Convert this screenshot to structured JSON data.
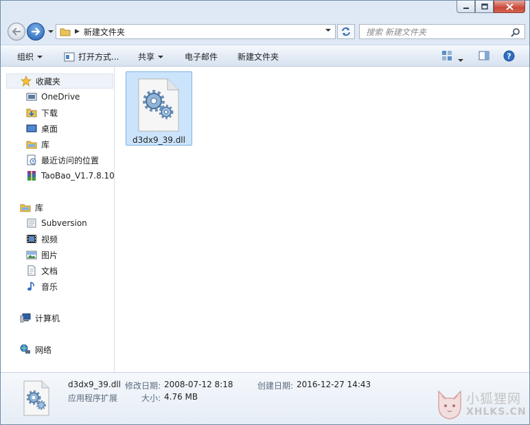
{
  "window": {
    "controls": {
      "minimize_icon": "minimize-icon",
      "maximize_icon": "maximize-icon",
      "close_icon": "close-icon"
    }
  },
  "address": {
    "path": "新建文件夹",
    "search_placeholder": "搜索 新建文件夹"
  },
  "toolbar": {
    "organize": "组织",
    "open_with": "打开方式...",
    "share": "共享",
    "email": "电子邮件",
    "new_folder": "新建文件夹"
  },
  "sidebar": {
    "favorites": {
      "label": "收藏夹",
      "items": [
        {
          "label": "OneDrive",
          "icon": "onedrive-icon"
        },
        {
          "label": "下载",
          "icon": "downloads-folder-icon"
        },
        {
          "label": "桌面",
          "icon": "desktop-icon"
        },
        {
          "label": "库",
          "icon": "library-folder-icon"
        },
        {
          "label": "最近访问的位置",
          "icon": "recent-places-icon"
        },
        {
          "label": "TaoBao_V1.7.8.10_",
          "icon": "winrar-archive-icon"
        }
      ]
    },
    "libraries": {
      "label": "库",
      "items": [
        {
          "label": "Subversion",
          "icon": "subversion-library-icon"
        },
        {
          "label": "视频",
          "icon": "video-library-icon"
        },
        {
          "label": "图片",
          "icon": "pictures-library-icon"
        },
        {
          "label": "文档",
          "icon": "documents-library-icon"
        },
        {
          "label": "音乐",
          "icon": "music-library-icon"
        }
      ]
    },
    "computer": {
      "label": "计算机"
    },
    "network": {
      "label": "网络"
    }
  },
  "files": [
    {
      "name": "d3dx9_39.dll",
      "icon": "dll-file-icon",
      "selected": true
    }
  ],
  "details": {
    "name": "d3dx9_39.dll",
    "type": "应用程序扩展",
    "modified_label": "修改日期:",
    "modified_value": "2008-07-12 8:18",
    "created_label": "创建日期:",
    "created_value": "2016-12-27 14:43",
    "size_label": "大小:",
    "size_value": "4.76 MB"
  },
  "watermark": {
    "cn": "小狐狸网",
    "en": "XHLKS.CN"
  },
  "colors": {
    "selection_fill": "#cce4fb",
    "selection_border": "#7dafe6",
    "close_button": "#c8493a",
    "forward_button": "#1f5fb1"
  }
}
